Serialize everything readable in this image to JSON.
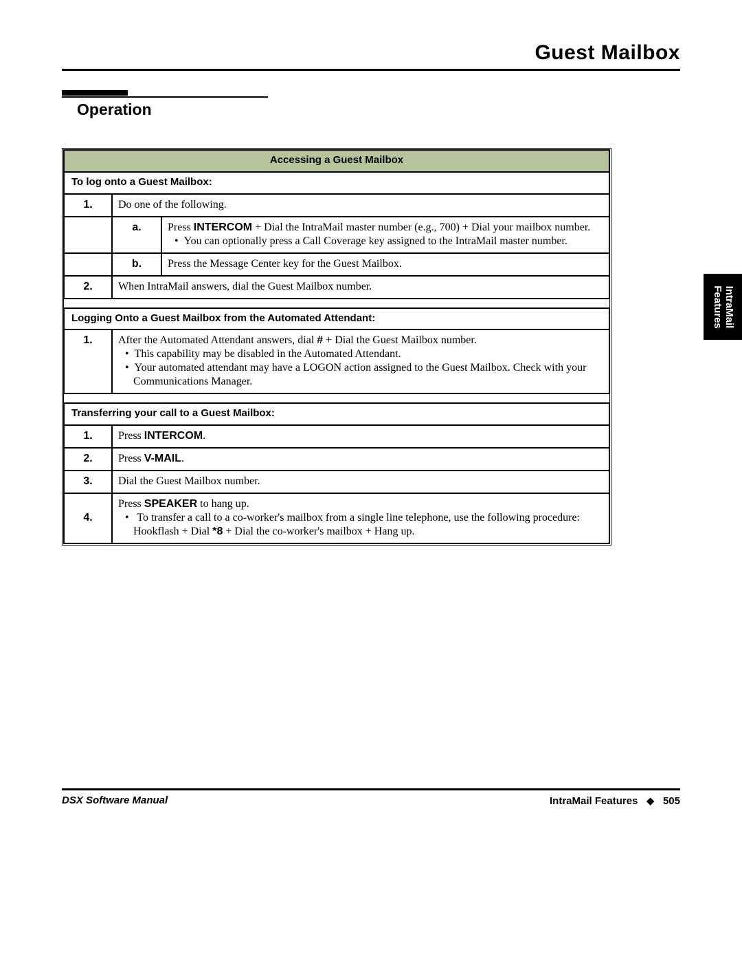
{
  "header": {
    "title": "Guest Mailbox"
  },
  "section": {
    "title": "Operation"
  },
  "sideTab": {
    "line1": "IntraMail",
    "line2": "Features"
  },
  "table": {
    "titleRow": "Accessing a Guest Mailbox",
    "sub1": "To log onto a Guest Mailbox:",
    "r1_num": "1.",
    "r1_text": "Do one of the following.",
    "r1a_letter": "a.",
    "r1a_prefix": "Press ",
    "r1a_kw": "INTERCOM",
    "r1a_rest": " + Dial the IntraMail master number (e.g., 700) + Dial your mailbox number.",
    "r1a_bullet": "You can optionally press a Call Coverage key assigned to the IntraMail master number.",
    "r1b_letter": "b.",
    "r1b_text": "Press the Message Center key for the Guest Mailbox.",
    "r2_num": "2.",
    "r2_text": "When IntraMail answers, dial the Guest Mailbox number.",
    "sub2": "Logging Onto a Guest Mailbox from the Automated Attendant:",
    "r3_num": "1.",
    "r3_p1": "After the Automated Attendant answers, dial ",
    "r3_kw": "#",
    "r3_p2": " + Dial the Guest Mailbox number.",
    "r3_b1": "This capability may be disabled in the Automated Attendant.",
    "r3_b2": "Your automated attendant may have a LOGON action assigned to the Guest Mailbox. Check with your Communications Manager.",
    "sub3": "Transferring your call to a Guest Mailbox:",
    "t1_num": "1.",
    "t1_p1": "Press ",
    "t1_kw": "INTERCOM",
    "t1_p2": ".",
    "t2_num": "2.",
    "t2_p1": "Press ",
    "t2_kw": "V-MAIL",
    "t2_p2": ".",
    "t3_num": "3.",
    "t3_text": "Dial the Guest Mailbox number.",
    "t4_num": "4.",
    "t4_p1": "Press ",
    "t4_kw": "SPEAKER",
    "t4_p2": " to hang up.",
    "t4_b_pre": "To transfer a call to a co-worker's mailbox from a single line telephone, use the following procedure: Hookflash + Dial ",
    "t4_b_kw": "*8",
    "t4_b_post": " + Dial the co-worker's mailbox + Hang up."
  },
  "footer": {
    "left": "DSX Software Manual",
    "rightLabel": "IntraMail Features",
    "diamond": "◆",
    "page": "505"
  }
}
